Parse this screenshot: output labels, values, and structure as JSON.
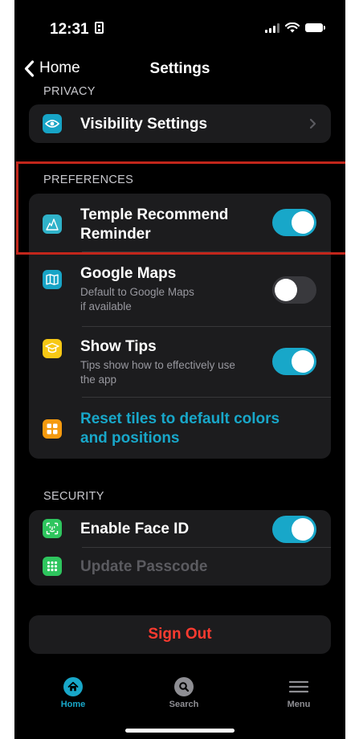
{
  "status": {
    "time": "12:31"
  },
  "nav": {
    "back_label": "Home",
    "title": "Settings"
  },
  "privacy": {
    "header": "PRIVACY",
    "items": [
      {
        "title": "Visibility Settings"
      }
    ]
  },
  "preferences": {
    "header": "PREFERENCES",
    "items": [
      {
        "title_line1": "Temple Recommend",
        "title_line2": "Reminder",
        "toggle": true
      },
      {
        "title": "Google Maps",
        "subtitle_line1": "Default to Google Maps",
        "subtitle_line2": "if available",
        "toggle": false
      },
      {
        "title": "Show Tips",
        "subtitle_line1": "Tips show how to effectively use",
        "subtitle_line2": "the app",
        "toggle": true
      },
      {
        "title_line1": "Reset tiles to default colors",
        "title_line2": "and positions"
      }
    ]
  },
  "security": {
    "header": "SECURITY",
    "items": [
      {
        "title": "Enable Face ID",
        "toggle": true
      },
      {
        "title": "Update Passcode"
      }
    ]
  },
  "sign_out_label": "Sign Out",
  "tabs": [
    {
      "label": "Home",
      "active": true
    },
    {
      "label": "Search",
      "active": false
    },
    {
      "label": "Menu",
      "active": false
    }
  ],
  "colors": {
    "accent": "#18a7c9",
    "sign_out": "#ff3b30",
    "background": "#000000",
    "card": "#1c1c1e",
    "highlight_border": "#c2261b"
  }
}
